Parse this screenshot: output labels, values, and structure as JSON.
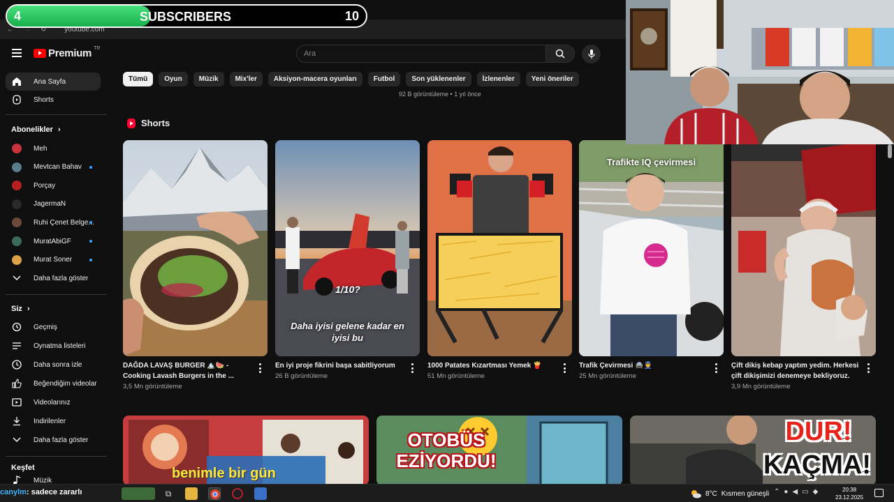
{
  "overlay": {
    "current": "4",
    "label": "SUBSCRIBERS",
    "goal": "10",
    "progress": 0.4
  },
  "browser": {
    "url": "youtube.com"
  },
  "masthead": {
    "logo": "Premium",
    "logo_sup": "TR",
    "search_placeholder": "Ara"
  },
  "sidebar": {
    "home": "Ana Sayfa",
    "shorts": "Shorts",
    "subs_header": "Abonelikler",
    "channels": [
      {
        "name": "Meh",
        "dot": false,
        "color": "#c8323c"
      },
      {
        "name": "Mevtcan Bahav",
        "dot": true,
        "color": "#5a7d8c"
      },
      {
        "name": "Porçay",
        "dot": false,
        "color": "#b82020"
      },
      {
        "name": "JagermaN",
        "dot": false,
        "color": "#2a2a2a"
      },
      {
        "name": "Ruhi Çenet Belge...",
        "dot": true,
        "color": "#6b4a3a"
      },
      {
        "name": "MuratAbiGF",
        "dot": true,
        "color": "#3d6b5a"
      },
      {
        "name": "Murat Soner",
        "dot": true,
        "color": "#d9a24a"
      }
    ],
    "more_subs": "Daha fazla göster",
    "you_header": "Siz",
    "you_items": [
      "Geçmiş",
      "Oynatma listeleri",
      "Daha sonra izle",
      "Beğendiğim videolar",
      "Videolarınız",
      "İndirilenler",
      "Daha fazla göster"
    ],
    "explore_header": "Keşfet",
    "explore_first": "Müzik"
  },
  "chips": [
    "Tümü",
    "Oyun",
    "Müzik",
    "Mix'ler",
    "Aksiyon-macera oyunları",
    "Futbol",
    "Son yüklenenler",
    "İzlenenler",
    "Yeni öneriler"
  ],
  "views_top": "92 B görüntüleme • 1 yıl önce",
  "shorts_header": "Shorts",
  "shorts": [
    {
      "title": "DAĞDA LAVAŞ BURGER 🏔️🍉 - Cooking Lavash Burgers in the ...",
      "views": "3,5 Mn görüntüleme"
    },
    {
      "title": "En iyi proje fikrini başa sabitliyorum",
      "views": "26 B görüntüleme",
      "overlay1": "1/10?",
      "overlay2": "Daha iyisi gelene kadar en iyisi bu"
    },
    {
      "title": "1000 Patates Kızartması Yemek 🍟",
      "views": "51 Mn görüntüleme"
    },
    {
      "title": "Trafik Çevirmesi 🚔👮",
      "views": "25 Mn görüntüleme",
      "overlay1": "Trafikte IQ çevirmesi"
    },
    {
      "title": "Çift dikiş kebap yaptım yedim. Herkesi çift dikişimizi  denemeye bekliyoruz.",
      "views": "3,9 Mn görüntüleme"
    }
  ],
  "videos": [
    {
      "overlay": "benimle bir gün"
    },
    {
      "overlay": "OTOBÜS EZİYORDU!"
    },
    {
      "overlay1": "DUR!",
      "overlay2": "KAÇMA!"
    }
  ],
  "taskbar": {
    "ticker_user": "canylm",
    "ticker_text": ": sadece zararlı",
    "temp": "8°C",
    "weather": "Kısmen güneşli",
    "time": "20:38",
    "date": "23.12.2025"
  }
}
